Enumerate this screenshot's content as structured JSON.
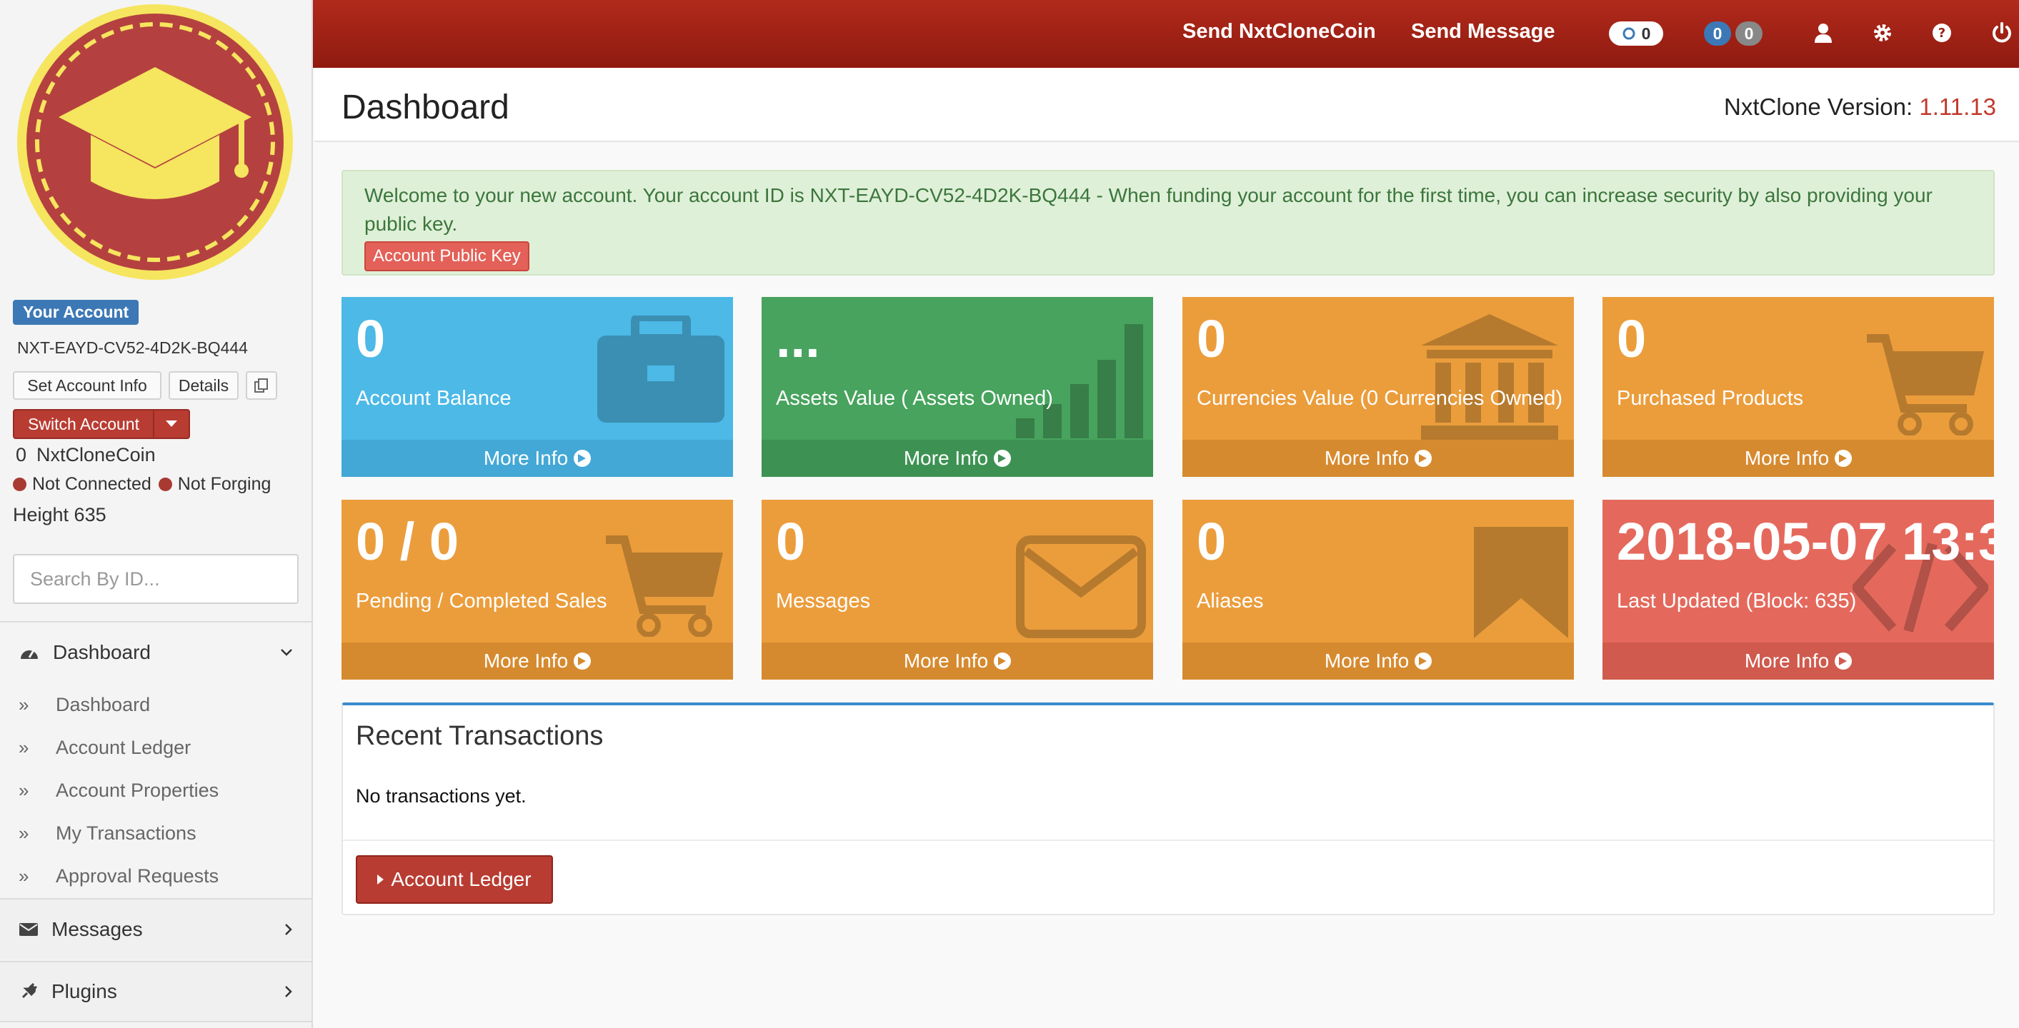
{
  "header": {
    "send_coin": "Send NxtCloneCoin",
    "send_message": "Send Message",
    "pill_transactions": "0",
    "pill_blue": "0",
    "pill_gray": "0",
    "icons": [
      "user-icon",
      "gear-icon",
      "question-icon",
      "power-icon"
    ]
  },
  "sidebar": {
    "account_badge": "Your Account",
    "account_id": "NXT-EAYD-CV52-4D2K-BQ444",
    "set_account_info": "Set Account Info",
    "details": "Details",
    "switch_account": "Switch Account",
    "balance": "0",
    "coin": "NxtCloneCoin",
    "not_connected": "Not Connected",
    "not_forging": "Not Forging",
    "height": "Height 635",
    "search_placeholder": "Search By ID...",
    "dashboard_section": "Dashboard",
    "items": [
      "Dashboard",
      "Account Ledger",
      "Account Properties",
      "My Transactions",
      "Approval Requests"
    ],
    "messages_section": "Messages",
    "plugins_section": "Plugins"
  },
  "content": {
    "page_title": "Dashboard",
    "version_label": "NxtClone Version:",
    "version_number": "1.11.13",
    "alert_text": "Welcome to your new account. Your account ID is NXT-EAYD-CV52-4D2K-BQ444 - When funding your account for the first time, you can increase security by also providing your public key.",
    "alert_button": "Account Public Key"
  },
  "tiles": [
    {
      "value": "0",
      "caption": "Account Balance",
      "more": "More Info"
    },
    {
      "value": "...",
      "caption": "Assets Value ( Assets Owned)",
      "more": "More Info"
    },
    {
      "value": "0",
      "caption": "Currencies Value (0 Currencies Owned)",
      "more": "More Info"
    },
    {
      "value": "0",
      "caption": "Purchased Products",
      "more": "More Info"
    },
    {
      "value": "0 / 0",
      "caption": "Pending / Completed Sales",
      "more": "More Info"
    },
    {
      "value": "0",
      "caption": "Messages",
      "more": "More Info"
    },
    {
      "value": "0",
      "caption": "Aliases",
      "more": "More Info"
    },
    {
      "value": "2018-05-07 13:3",
      "caption": "Last Updated (Block: 635)",
      "more": "More Info"
    }
  ],
  "recent": {
    "title": "Recent Transactions",
    "empty": "No transactions yet.",
    "ledger_button": "Account Ledger"
  },
  "colors": {
    "header": "#a0221a",
    "tile_blue": "#4cb9e7",
    "tile_green": "#47a35d",
    "tile_orange": "#eb9d3c",
    "tile_red": "#e4695c",
    "accent_red": "#b83c32"
  }
}
